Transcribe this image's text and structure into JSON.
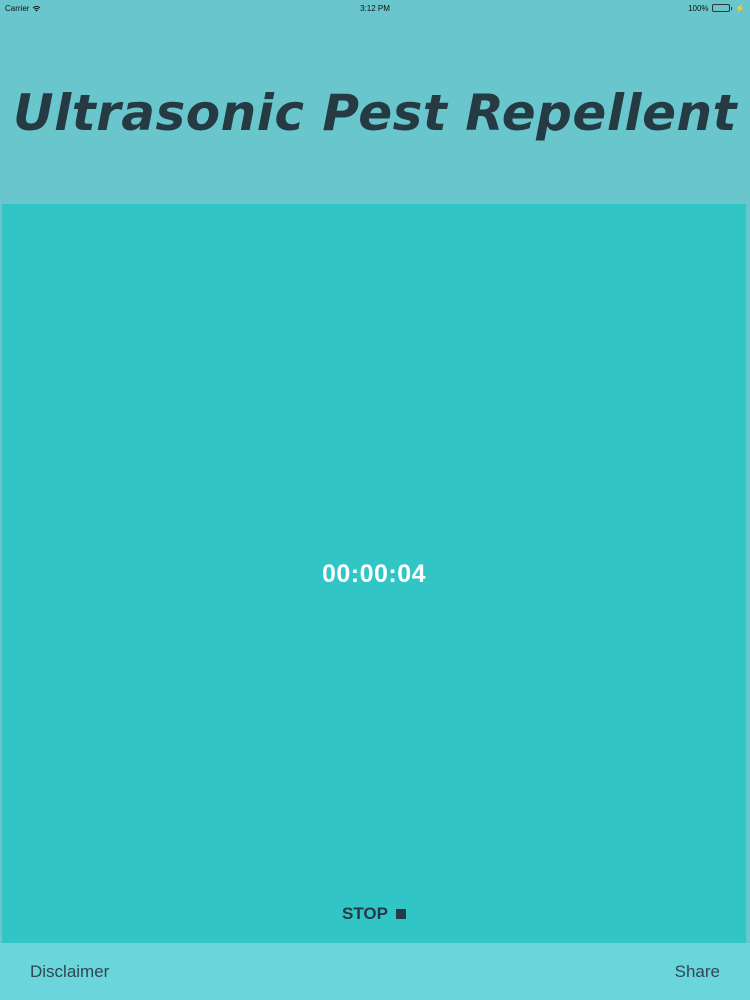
{
  "status_bar": {
    "carrier": "Carrier",
    "time": "3:12 PM",
    "battery": "100%"
  },
  "header": {
    "title": "Ultrasonic Pest Repellent"
  },
  "main": {
    "timer": "00:00:04",
    "stop_label": "STOP"
  },
  "footer": {
    "disclaimer_label": "Disclaimer",
    "share_label": "Share"
  },
  "colors": {
    "background": "#69c6cc",
    "panel": "#31c5c5",
    "footer": "#6bd5dc",
    "title_text": "#263a44"
  },
  "icons": {
    "wifi": "wifi-icon",
    "battery": "battery-icon",
    "stop": "stop-square-icon"
  }
}
